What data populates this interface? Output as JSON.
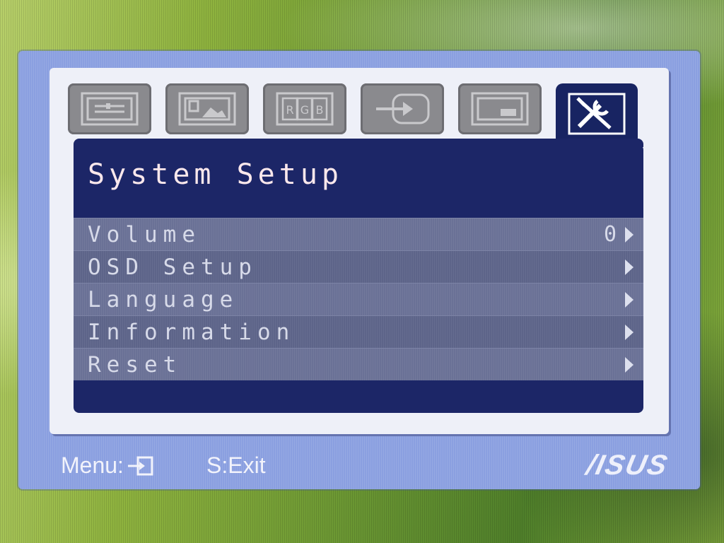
{
  "osd": {
    "title": "System Setup",
    "tabs": [
      {
        "name": "splendid-icon",
        "label": ""
      },
      {
        "name": "image-icon",
        "label": ""
      },
      {
        "name": "color-rgb-icon",
        "label": "R G B"
      },
      {
        "name": "input-select-icon",
        "label": ""
      },
      {
        "name": "pip-icon",
        "label": ""
      },
      {
        "name": "system-setup-icon",
        "label": "",
        "active": true
      }
    ],
    "menu_items": [
      {
        "label": "Volume",
        "value": "0"
      },
      {
        "label": "OSD Setup",
        "value": ""
      },
      {
        "label": "Language",
        "value": ""
      },
      {
        "label": "Information",
        "value": ""
      },
      {
        "label": "Reset",
        "value": ""
      }
    ],
    "footer": {
      "menu_label": "Menu:",
      "exit_label": "S:Exit",
      "brand": "/ISUS"
    }
  }
}
